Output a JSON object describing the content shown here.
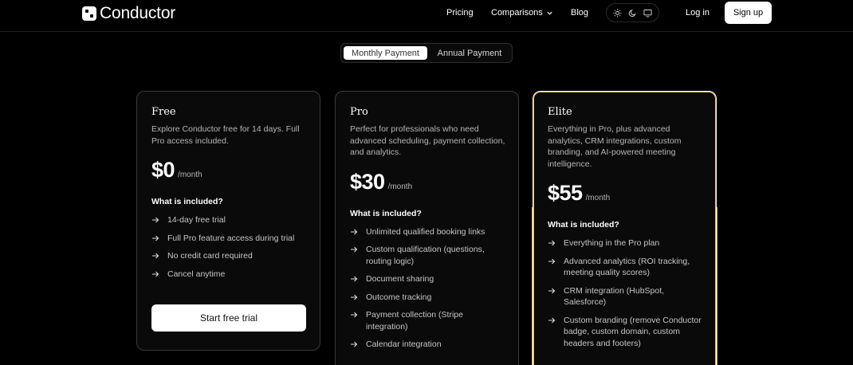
{
  "brand": {
    "name": "Conductor"
  },
  "nav": {
    "pricing": "Pricing",
    "comparisons": "Comparisons",
    "blog": "Blog",
    "login": "Log in",
    "signup": "Sign up"
  },
  "theme_icons": [
    "sun-icon",
    "moon-icon",
    "monitor-icon"
  ],
  "billing": {
    "monthly": "Monthly Payment",
    "annual": "Annual Payment",
    "selected": "Monthly Payment"
  },
  "plans": [
    {
      "name": "Free",
      "description": "Explore Conductor free for 14 days. Full Pro access included.",
      "price": "$0",
      "period": "/month",
      "included_label": "What is included?",
      "features": [
        "14-day free trial",
        "Full Pro feature access during trial",
        "No credit card required",
        "Cancel anytime"
      ],
      "cta": "Start free trial"
    },
    {
      "name": "Pro",
      "description": "Perfect for professionals who need advanced scheduling, payment collection, and analytics.",
      "price": "$30",
      "period": "/month",
      "included_label": "What is included?",
      "features": [
        "Unlimited qualified booking links",
        "Custom qualification (questions, routing logic)",
        "Document sharing",
        "Outcome tracking",
        "Payment collection (Stripe integration)",
        "Calendar integration"
      ]
    },
    {
      "name": "Elite",
      "description": "Everything in Pro, plus advanced analytics, CRM integrations, custom branding, and AI-powered meeting intelligence.",
      "price": "$55",
      "period": "/month",
      "included_label": "What is included?",
      "features": [
        "Everything in the Pro plan",
        "Advanced analytics (ROI tracking, meeting quality scores)",
        "CRM integration (HubSpot, Salesforce)",
        "Custom branding (remove Conductor badge, custom domain, custom headers and footers)"
      ]
    }
  ],
  "colors": {
    "background": "#000000",
    "card": "#0a0a0a",
    "elite_accent": "#d9b93a"
  }
}
